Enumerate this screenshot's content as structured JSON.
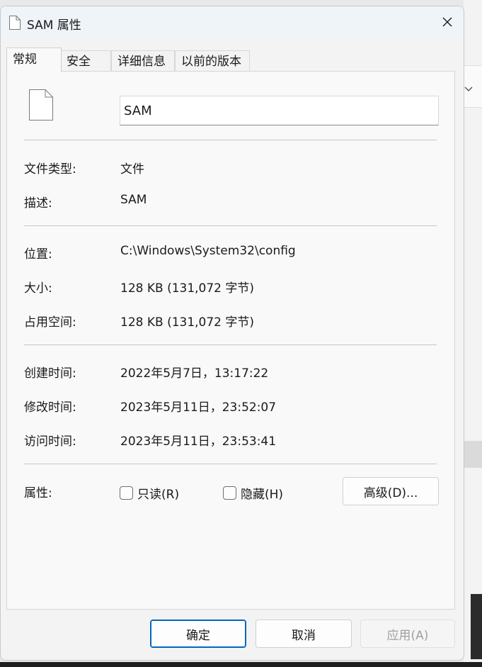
{
  "window": {
    "title": "SAM 属性",
    "close_icon": "close-icon"
  },
  "tabs": [
    {
      "label": "常规",
      "active": true
    },
    {
      "label": "安全",
      "active": false
    },
    {
      "label": "详细信息",
      "active": false
    },
    {
      "label": "以前的版本",
      "active": false
    }
  ],
  "general": {
    "file_name": "SAM",
    "file_type_label": "文件类型:",
    "file_type_value": "文件",
    "description_label": "描述:",
    "description_value": "SAM",
    "location_label": "位置:",
    "location_value": "C:\\Windows\\System32\\config",
    "size_label": "大小:",
    "size_value": "128 KB (131,072 字节)",
    "size_on_disk_label": "占用空间:",
    "size_on_disk_value": "128 KB (131,072 字节)",
    "created_label": "创建时间:",
    "created_value": "2022年5月7日，13:17:22",
    "modified_label": "修改时间:",
    "modified_value": "2023年5月11日，23:52:07",
    "accessed_label": "访问时间:",
    "accessed_value": "2023年5月11日，23:53:41",
    "attributes_label": "属性:",
    "readonly_label": "只读(R)",
    "readonly_checked": false,
    "hidden_label": "隐藏(H)",
    "hidden_checked": false,
    "advanced_button": "高级(D)..."
  },
  "footer": {
    "ok_label": "确定",
    "cancel_label": "取消",
    "apply_label": "应用(A)"
  },
  "colors": {
    "accent": "#0067c0",
    "titlebar": "#eff4f9"
  }
}
